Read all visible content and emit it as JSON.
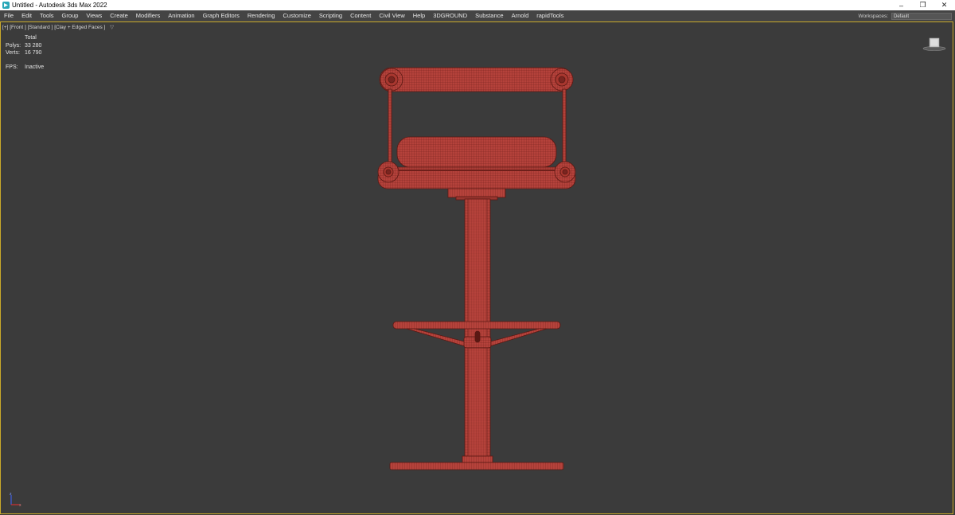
{
  "window": {
    "title": "Untitled - Autodesk 3ds Max 2022",
    "app_icon": "3ds-max-icon",
    "controls": {
      "minimize": "–",
      "restore": "❐",
      "close": "✕"
    }
  },
  "menubar": {
    "items": [
      "File",
      "Edit",
      "Tools",
      "Group",
      "Views",
      "Create",
      "Modifiers",
      "Animation",
      "Graph Editors",
      "Rendering",
      "Customize",
      "Scripting",
      "Content",
      "Civil View",
      "Help",
      "3DGROUND",
      "Substance",
      "Arnold",
      "rapidTools"
    ],
    "workspaces_label": "Workspaces:",
    "workspaces_value": "Default"
  },
  "viewport": {
    "label": "[+] [Front ] [Standard ] [Clay + Edged Faces ]",
    "filter_icon": "filter-icon",
    "stats": {
      "header": "Total",
      "polys_label": "Polys:",
      "polys_value": "33 280",
      "verts_label": "Verts:",
      "verts_value": "16 790"
    },
    "fps_label": "FPS:",
    "fps_value": "Inactive",
    "border_color": "#c9a92a",
    "background": "#3b3b3b",
    "model_color": "#b5423b"
  }
}
